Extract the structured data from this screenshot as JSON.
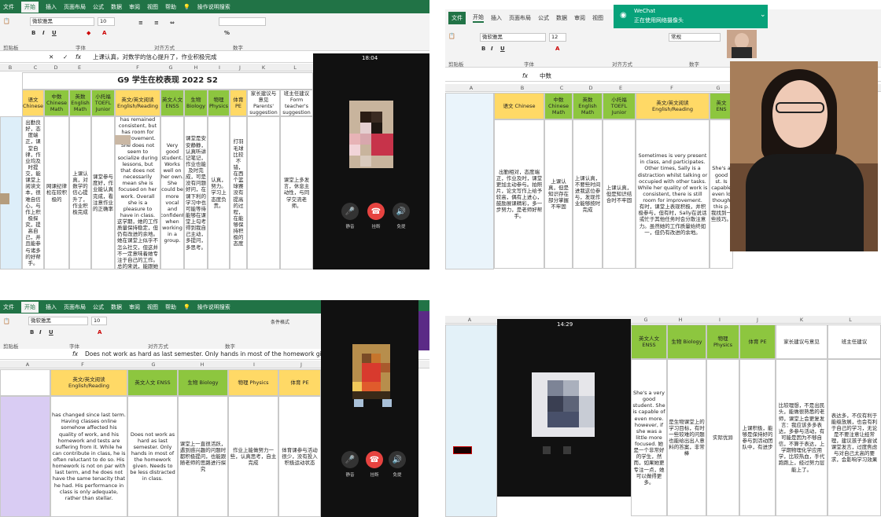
{
  "excel": {
    "menu": [
      "文件",
      "开始",
      "插入",
      "页面布局",
      "公式",
      "数据",
      "审阅",
      "视图",
      "帮助"
    ],
    "tell_me": "操作说明搜索",
    "font_name": "微软雅黑",
    "font_size": "10",
    "font_size_tr": "12",
    "style_name": "常规",
    "groups": {
      "clipboard": "剪贴板",
      "font": "字体",
      "align": "对齐方式",
      "number": "数字",
      "styles": "样式",
      "cells": "单元格",
      "edit": "编辑"
    },
    "buttons": {
      "paste": "粘贴",
      "cond_format": "条件格式",
      "table_format": "套用表格格式",
      "cell_style": "单元格样式",
      "insert": "插入",
      "delete": "删除",
      "format": "格式",
      "sort": "排序和筛选"
    }
  },
  "tl": {
    "formula": "上课认真，对数学的信心提升了，作业积极完成",
    "title": "G9 学生在校表现 2022 S2",
    "headers": [
      "语文 Chinese",
      "中数 Chinese Math",
      "英数 English Math",
      "小托福 TOEFL Junior",
      "英文/英文阅读 English/Reading",
      "英文人文 ENSS",
      "生物 Biology",
      "物理 Physics",
      "体育 PE",
      "家长建议与意见 Parents' suggestion",
      "班主任建议 Form teacher's suggestion"
    ],
    "cells": {
      "chinese": "出勤良好，态度端正，课堂自律，作业均及时提交，能课堂上阅读文本，很难自信心，与作上积极探究，提高自己，并且能参与诸多的好帮手。",
      "cmath": "网课纪律松在较积极的",
      "emath": "上课认真，对数学的信心提升了，作业积极完成",
      "toefl": "课堂参与度好，作业能认真完成，看注意作业的正确率",
      "reading_en": "has been very this term. Her quality of work has remained consistent, but has room for improvement. She does not seem to socialize during lessons, but that does not necessarily mean she is focused on her work. Overall she is a pleasure to have in class.",
      "reading_cn": "这学期，她的工作质量保持稳定，但仍有改进的余地。她在课堂上似乎不怎么社交，但这并不一定意味着她专注于自己的工作。总的来说，能跟她在一起上课是Yewon这样的学生。",
      "enss": "Very good student. Works well on her own. She could be more vocal and confident when working in a group.",
      "bio": "课堂是安安静静，认真听讲记笔记，作业也能及时完成，可是没有问题好问，在课下利的学习中也可能等待能够在课堂上勾考得到我自己主动，多提问，多思考。",
      "physics": "认真，努力。学习上态度负责。",
      "pe": "打羽毛球比较不错，在西个篮球赛没有提高的过程，在能够保持积极的态度",
      "parent": "",
      "teacher": "课堂上多发言，休息主动性，与同学交流老师。"
    },
    "call": {
      "time": "18:04",
      "mute": "静音",
      "hangup": "挂断",
      "speaker": "免提"
    }
  },
  "tr": {
    "formula": "中数",
    "headers": [
      "语文 Chinese",
      "中数 Chinese Math",
      "英数 English Math",
      "小托福 TOEFL Junior",
      "英文/英文阅读 English/Reading",
      "英文 ENS"
    ],
    "cells": {
      "chinese": "出勤相对，态度端正，作业及时，课堂更加主动参与。拍照片，论文写作上给予较高，偶有上进心，鼓励展课精彩，多一步努力，是老师好帮手。",
      "cmath": "上课认真，但是知识存在部分掌握不牢固",
      "emath": "上课认真，不要些时间进我这位参与，发现作业能够按时完成",
      "toefl": "上课认真，但是知识结合时不牢固",
      "reading": "Sometimes is very present in class, and participates. Other times, Sally is a distraction whilst talking or occupied with other tasks. While her quality of work is consistent, there is still room for improvement.",
      "reading_cn": "有时，课堂上表现积极，并积极参与，但有时，Sally在说话或忙于其他任务时会分散注意力。虽然她的工作质量始终如一，但仍有改进的余地。",
      "enss": "She's a good st. Is capable even lo though this p. 我找到一些技巧。"
    },
    "wechat": {
      "title": "WeChat",
      "subtitle": "正在使用网络摄像头"
    }
  },
  "bl": {
    "formula": "Does not work as hard as last semester. Only hands in most of the homework given. Needs to be less distracted",
    "headers": [
      "英文/英文阅读 English/Reading",
      "英文人文 ENSS",
      "生物 Biology",
      "物理 Physics",
      "体育 PE"
    ],
    "cells": {
      "reading": "has changed since last term. Having classes online somehow affected his quality of work, and his homework and tests are suffering from it. While he can contribute in class, he is often reluctant to do so. His homework is not on par with last term, and he does not have the same tenacity that he had. His performance in class is only adequate, rather than stellar.",
      "enss": "Does not work as hard as last semester. Only hands in most of the homework given. Needs to be less distracted in class.",
      "bio": "课堂上一直很活跃，遇到感兴趣的问题时都积极提问，也能跟随老师的思路进行探究",
      "physics": "作业上能做努力一些，认真思考，自主完成",
      "pe": "体育课参与活动很少，没有投入积极运动状态"
    },
    "call": {
      "mute": "静音",
      "hangup": "挂断",
      "speaker": "免提"
    }
  },
  "br": {
    "headers": [
      "英文人文 ENSS",
      "生物 Biology",
      "物理 Physics",
      "体育 PE",
      "家长建议与意见",
      "班主任建议"
    ],
    "cells": {
      "enss": "She's a very good student. She is capable of even more. however, if she was a little more focused. 她是一个非常好的学生，然而，如果她更专注一点，她可以做得更多。",
      "bio": "是生物课堂上的学习目标，有时一些较难的问题也能给出出人意料的答案，非常棒",
      "physics": "实际优异",
      "pe": "上课积极，能够是保持好的参与到活动团队中，有进步",
      "parent": "比较理想，不是出民头，能做很熟悉的老师，课堂上会更复发言：我应该多多表达，多参与活动，有可能是因为不够自信，不算于表达，上学期物理化学应用学，比较热血，手代跑跑上，经过努力层能上了。",
      "teacher": "表达多，不仅有利于能级放展，也会有利于自己的学习，无论是不要注意让经常理，建议孩子多尝试课堂发言，过度焦虑与对自己太高的要求，会影响学习效果"
    },
    "call": {
      "time": "14:29"
    }
  },
  "colors": {
    "excel_green": "#217346",
    "header_yellow": "#ffd966",
    "header_green": "#8dc63f",
    "cell_blue": "#ddeef9",
    "cell_purple": "#d9ccf3",
    "hangup_red": "#e64340",
    "wechat_teal": "#07a27a"
  }
}
